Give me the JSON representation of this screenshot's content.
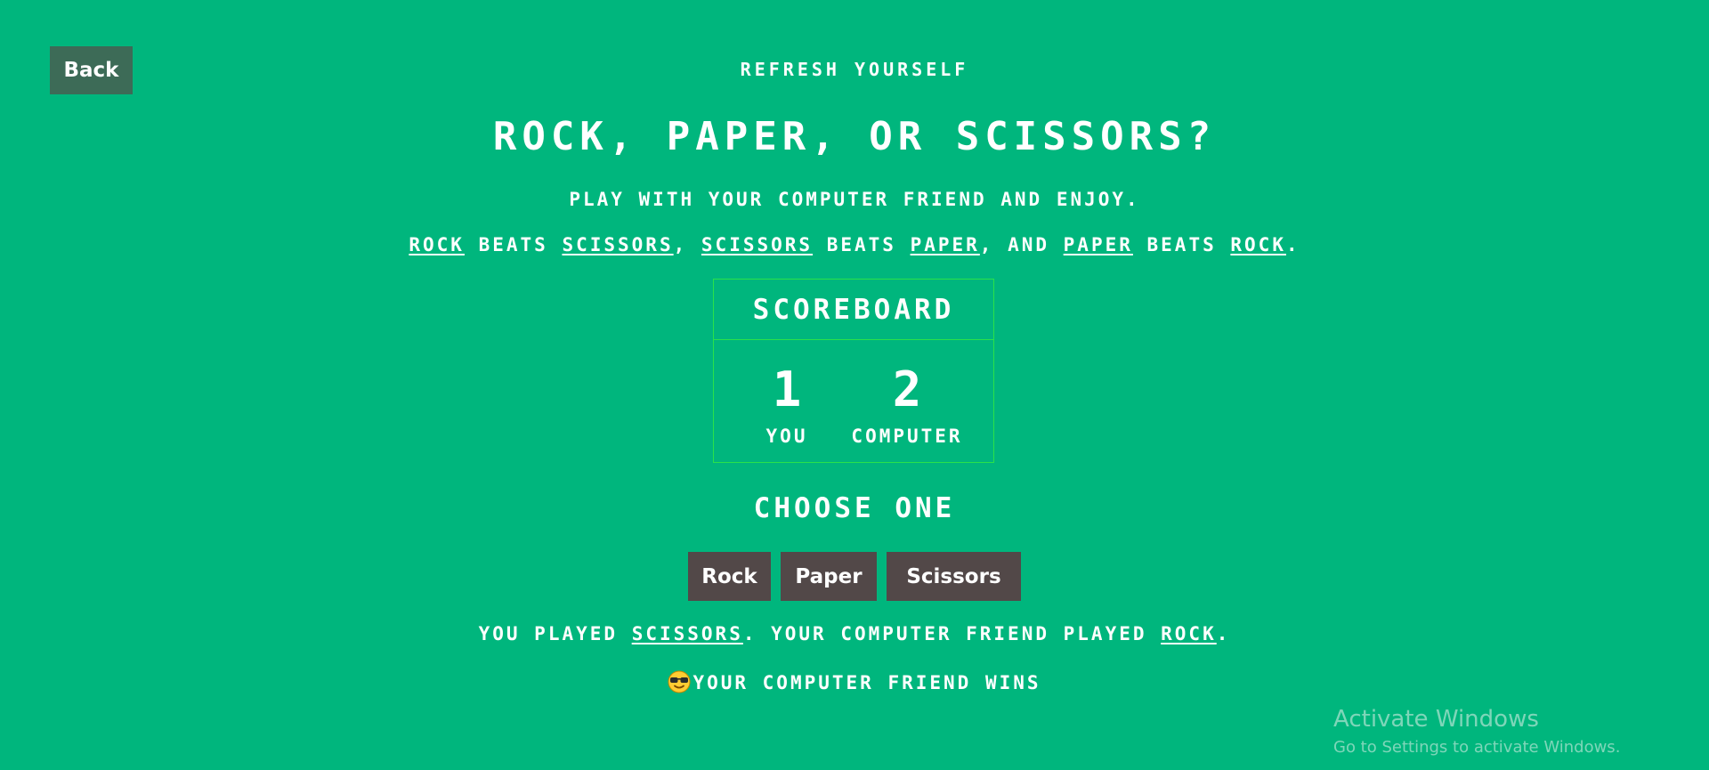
{
  "header": {
    "back_label": "Back",
    "kicker": "REFRESH YOURSELF",
    "title": "ROCK, PAPER, OR SCISSORS?",
    "subtitle": "PLAY WITH YOUR COMPUTER FRIEND AND ENJOY."
  },
  "rules": {
    "w1": "ROCK",
    "t1": " BEATS ",
    "w2": "SCISSORS",
    "t2": ", ",
    "w3": "SCISSORS",
    "t3": " BEATS ",
    "w4": "PAPER",
    "t4": ", AND ",
    "w5": "PAPER",
    "t5": " BEATS ",
    "w6": "ROCK",
    "t6": "."
  },
  "scoreboard": {
    "title": "SCOREBOARD",
    "you_score": "1",
    "you_label": "YOU",
    "computer_score": "2",
    "computer_label": "COMPUTER"
  },
  "choose": {
    "heading": "CHOOSE ONE",
    "options": [
      "Rock",
      "Paper",
      "Scissors"
    ]
  },
  "result": {
    "p1": "YOU PLAYED ",
    "player_choice": "SCISSORS",
    "p2": ". YOUR COMPUTER FRIEND PLAYED ",
    "computer_choice": "ROCK",
    "p3": ".",
    "outcome_icon": "sunglasses-emoji-icon",
    "outcome_text": "YOUR COMPUTER FRIEND WINS"
  },
  "watermark": {
    "title": "Activate Windows",
    "subtitle": "Go to Settings to activate Windows."
  },
  "colors": {
    "background": "#00b67d",
    "back_button": "#3d6b57",
    "choice_button": "#524848",
    "scoreboard_border": "#29e24a"
  }
}
